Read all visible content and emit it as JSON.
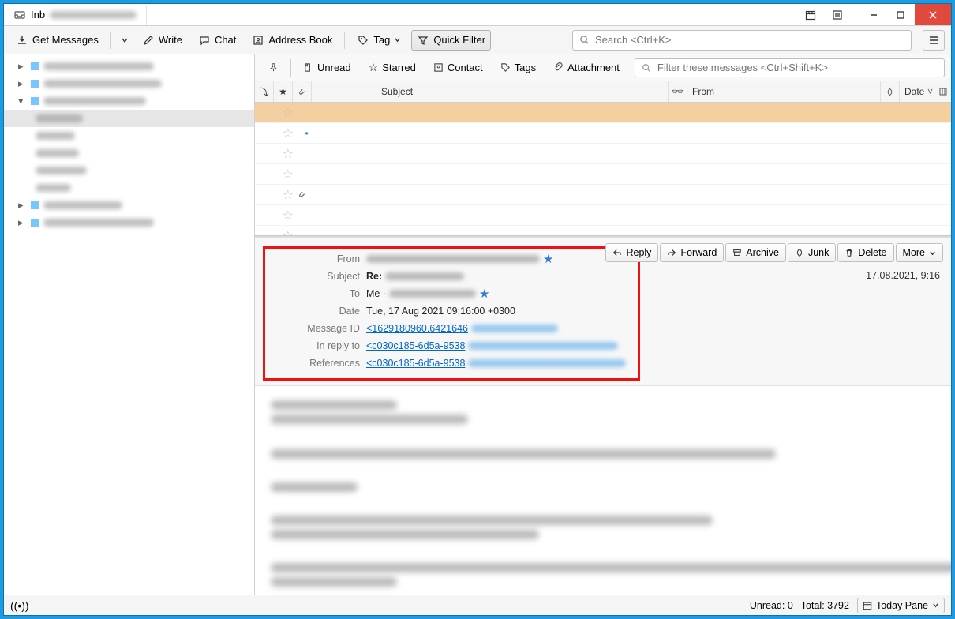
{
  "tab_title": "Inb",
  "main_toolbar": {
    "get_messages": "Get Messages",
    "write": "Write",
    "chat": "Chat",
    "address_book": "Address Book",
    "tag": "Tag",
    "quick_filter": "Quick Filter",
    "search_placeholder": "Search <Ctrl+K>"
  },
  "filter_bar": {
    "unread": "Unread",
    "starred": "Starred",
    "contact": "Contact",
    "tags": "Tags",
    "attachment": "Attachment",
    "filter_placeholder": "Filter these messages <Ctrl+Shift+K>"
  },
  "list_header": {
    "subject": "Subject",
    "from": "From",
    "date": "Date"
  },
  "header_pane": {
    "labels": {
      "from": "From",
      "subject": "Subject",
      "to": "To",
      "date": "Date",
      "message_id": "Message ID",
      "in_reply_to": "In reply to",
      "references": "References"
    },
    "values": {
      "subject_prefix": "Re:",
      "to": "Me ·",
      "date": "Tue, 17 Aug 2021 09:16:00 +0300",
      "msgid": "<1629180960.6421646",
      "inreply": "<c030c185-6d5a-9538",
      "refs": "<c030c185-6d5a-9538"
    },
    "timestamp": "17.08.2021, 9:16"
  },
  "actions": {
    "reply": "Reply",
    "forward": "Forward",
    "archive": "Archive",
    "junk": "Junk",
    "delete": "Delete",
    "more": "More"
  },
  "statusbar": {
    "unread": "Unread: 0",
    "total": "Total: 3792",
    "today_pane": "Today Pane"
  }
}
